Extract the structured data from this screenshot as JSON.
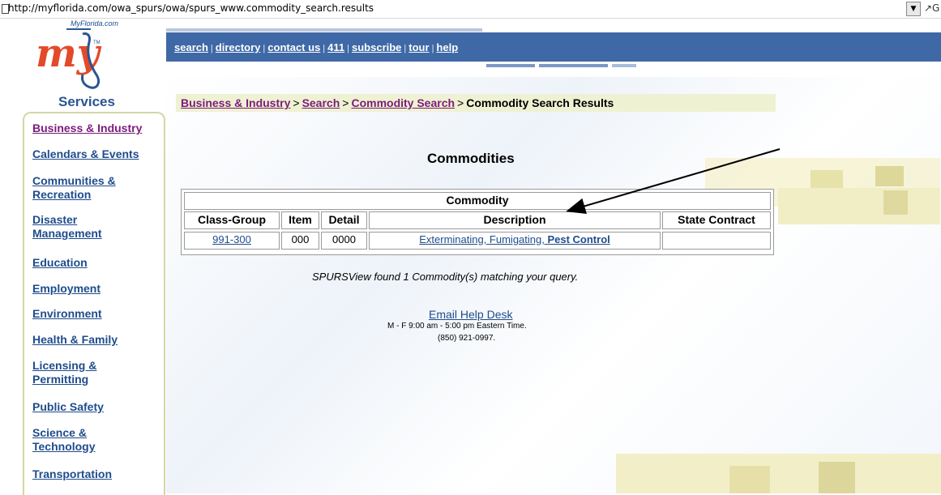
{
  "browser": {
    "url": "http://myflorida.com/owa_spurs/owa/spurs_www.commodity_search.results",
    "go_glyph": "↗G"
  },
  "logo": {
    "site_name": "MyFlorida.com",
    "wordmark": "my",
    "tm": "TM"
  },
  "topnav": {
    "links": [
      "search",
      "directory",
      "contact us",
      "411",
      "subscribe",
      "tour",
      "help"
    ],
    "separator": "|"
  },
  "sidebar": {
    "title": "Services",
    "items": [
      {
        "label": "Business & Industry"
      },
      {
        "label": "Calendars & Events"
      },
      {
        "label": "Communities & Recreation"
      },
      {
        "label": "Disaster Management"
      },
      {
        "label": "Education"
      },
      {
        "label": "Employment"
      },
      {
        "label": "Environment"
      },
      {
        "label": "Health & Family"
      },
      {
        "label": "Licensing & Permitting"
      },
      {
        "label": "Public Safety"
      },
      {
        "label": "Science & Technology"
      },
      {
        "label": "Transportation"
      }
    ]
  },
  "breadcrumb": {
    "items": [
      "Business & Industry",
      "Search",
      "Commodity Search"
    ],
    "current": "Commodity Search Results",
    "separator": ">"
  },
  "main": {
    "heading": "Commodities",
    "table": {
      "caption": "Commodity",
      "headers": [
        "Class-Group",
        "Item",
        "Detail",
        "Description",
        "State Contract"
      ],
      "rows": [
        {
          "class_group": "991-300",
          "item": "000",
          "detail": "0000",
          "description_prefix": "Exterminating, Fumigating, ",
          "description_emphasis": "Pest Control",
          "state_contract": ""
        }
      ]
    },
    "result_text": "SPURSView found 1 Commodity(s) matching your query.",
    "help_link": "Email Help Desk",
    "hours": "M - F 9:00 am - 5:00 pm Eastern Time.",
    "phone": "(850) 921-0997."
  },
  "colors": {
    "nav_blue": "#3f69a6",
    "link_blue": "#1e4c8c",
    "visited_purple": "#7b1b7b",
    "logo_orange": "#e34a2a",
    "breadcrumb_bg": "#eff1d3"
  }
}
